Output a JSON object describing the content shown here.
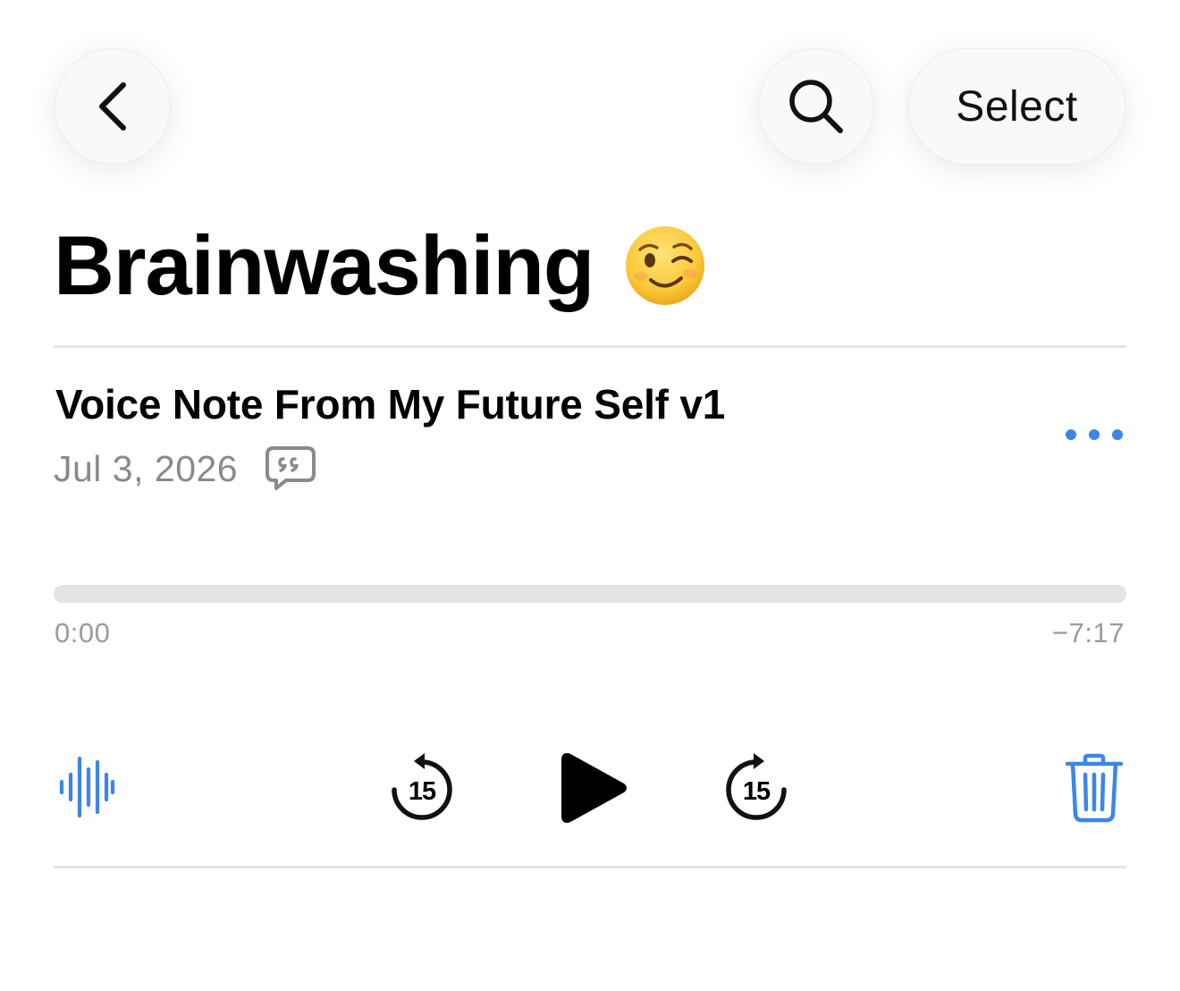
{
  "nav": {
    "back_icon": "chevron-left-icon",
    "search_icon": "magnifier-icon",
    "select_label": "Select"
  },
  "folder": {
    "title": "Brainwashing",
    "emoji": "winking-face"
  },
  "recording": {
    "title": "Voice Note From My Future Self v1",
    "date": "Jul 3, 2026",
    "has_transcript": true,
    "more_icon": "ellipsis-icon"
  },
  "playback": {
    "elapsed": "0:00",
    "remaining": "−7:17",
    "progress": 0,
    "skip_back_seconds": "15",
    "skip_forward_seconds": "15"
  },
  "colors": {
    "accent": "#3c86e8",
    "secondary_text": "#8a8a8e",
    "track": "#e3e3e3",
    "divider": "#e5e5e7"
  }
}
